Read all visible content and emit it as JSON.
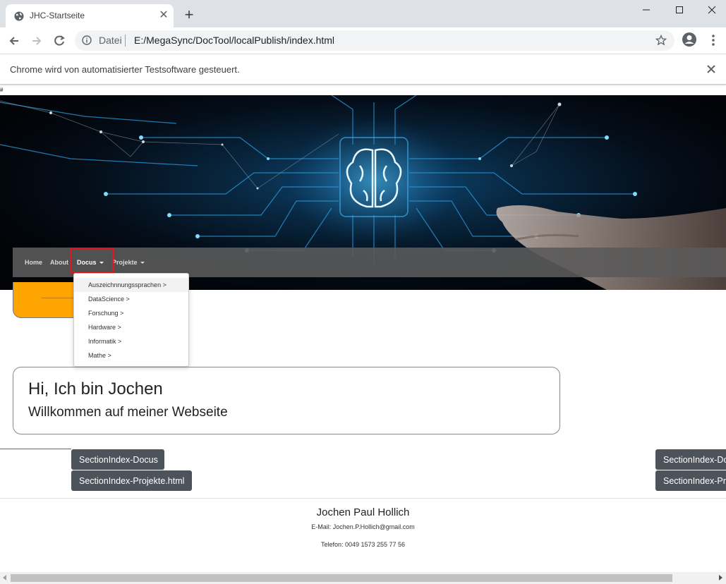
{
  "browser": {
    "tab_title": "JHC-Startseite",
    "address_scheme_label": "Datei",
    "address_url": "E:/MegaSync/DocTool/localPublish/index.html",
    "infobar_text": "Chrome wird von automatisierter Testsoftware gesteuert."
  },
  "page": {
    "hash_text": "#",
    "nav": {
      "items": [
        {
          "label": "Home"
        },
        {
          "label": "About"
        },
        {
          "label": "Docus"
        },
        {
          "label": "Projekte"
        }
      ]
    },
    "dropdown": {
      "items": [
        {
          "label": "Auszeichnnungssprachen >"
        },
        {
          "label": "DataScience >"
        },
        {
          "label": "Forschung >"
        },
        {
          "label": "Hardware >"
        },
        {
          "label": "Informatik >"
        },
        {
          "label": "Mathe >"
        }
      ]
    },
    "intro": {
      "title": "Hi, Ich bin Jochen",
      "subtitle": "Willkommen auf meiner Webseite"
    },
    "buttons": {
      "docus": "SectionIndex-Docus",
      "projekte": "SectionIndex-Projekte.html",
      "docus_right": "SectionIndex-Docus",
      "projekte_right": "SectionIndex-Projekte.html"
    },
    "footer": {
      "name": "Jochen Paul Hollich",
      "email": "E-Mail: Jochen.P.Hollich@gmail.com",
      "phone": "Telefon: 0049 1573 255 77 56"
    }
  },
  "colors": {
    "accent_highlight": "#e8131b",
    "orange_card": "#fea501",
    "button_bg": "#4d535a"
  }
}
